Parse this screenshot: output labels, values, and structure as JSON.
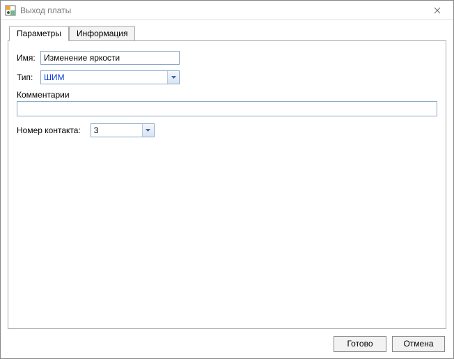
{
  "window": {
    "title": "Выход платы"
  },
  "tabs": {
    "t0": "Параметры",
    "t1": "Информация"
  },
  "form": {
    "name_label": "Имя:",
    "name_value": "Изменение яркости",
    "type_label": "Тип:",
    "type_value": "ШИМ",
    "comments_label": "Комментарии",
    "comments_value": "",
    "contact_label": "Номер контакта:",
    "contact_value": "3"
  },
  "buttons": {
    "ok": "Готово",
    "cancel": "Отмена"
  }
}
